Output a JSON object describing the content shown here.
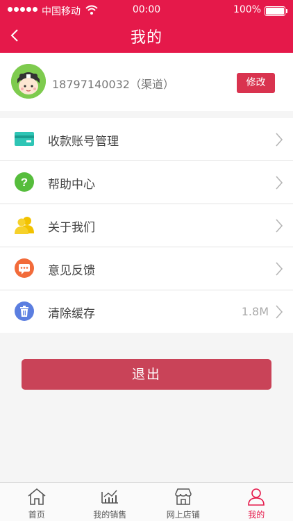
{
  "status_bar": {
    "carrier": "中国移动",
    "time": "00:00",
    "battery": "100%"
  },
  "header": {
    "title": "我的"
  },
  "profile": {
    "phone": "18797140032（渠道）",
    "edit_label": "修改"
  },
  "menu": {
    "items": [
      {
        "label": "收款账号管理",
        "icon": "card-icon",
        "value": ""
      },
      {
        "label": "帮助中心",
        "icon": "help-icon",
        "value": ""
      },
      {
        "label": "关于我们",
        "icon": "people-icon",
        "value": ""
      },
      {
        "label": "意见反馈",
        "icon": "feedback-icon",
        "value": ""
      },
      {
        "label": "清除缓存",
        "icon": "trash-icon",
        "value": "1.8M"
      }
    ]
  },
  "logout_label": "退出",
  "tabbar": {
    "tabs": [
      {
        "label": "首页",
        "icon": "home-icon"
      },
      {
        "label": "我的销售",
        "icon": "chart-icon"
      },
      {
        "label": "网上店铺",
        "icon": "store-icon"
      },
      {
        "label": "我的",
        "icon": "user-icon",
        "active": true
      }
    ]
  },
  "colors": {
    "brand": "#e5194a",
    "logout": "#c94358"
  }
}
